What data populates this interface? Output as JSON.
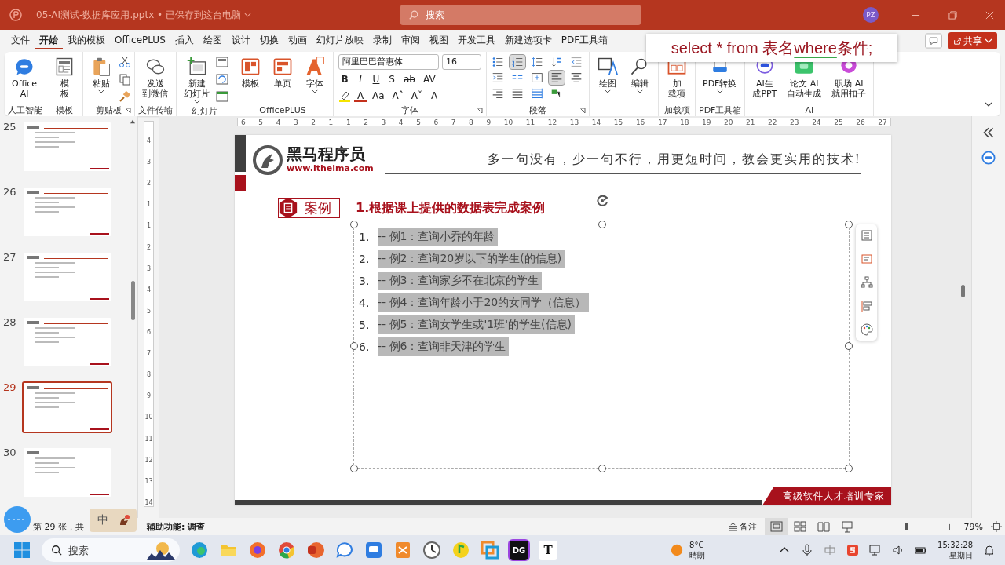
{
  "title_bar": {
    "file_title": "05-AI测试-数据库应用.pptx • 已保存到这台电脑",
    "search": {
      "placeholder": "搜索"
    },
    "avatar": "PZ"
  },
  "menu_tabs": [
    {
      "label": "文件",
      "selected": false
    },
    {
      "label": "开始",
      "selected": true
    },
    {
      "label": "我的模板",
      "selected": false
    },
    {
      "label": "OfficePLUS",
      "selected": false
    },
    {
      "label": "插入",
      "selected": false
    },
    {
      "label": "绘图",
      "selected": false
    },
    {
      "label": "设计",
      "selected": false
    },
    {
      "label": "切换",
      "selected": false
    },
    {
      "label": "动画",
      "selected": false
    },
    {
      "label": "幻灯片放映",
      "selected": false
    },
    {
      "label": "录制",
      "selected": false
    },
    {
      "label": "审阅",
      "selected": false
    },
    {
      "label": "视图",
      "selected": false
    },
    {
      "label": "开发工具",
      "selected": false
    },
    {
      "label": "新建选项卡",
      "selected": false
    },
    {
      "label": "PDF工具箱",
      "selected": false
    }
  ],
  "share_button": "共享",
  "sql_tooltip": {
    "before": "select * from 表名",
    "underlined": "where",
    "after": "条件;"
  },
  "ribbon_groups": [
    {
      "label": "人工智能",
      "kind": "large",
      "launcher": false,
      "items": [
        {
          "lines": [
            "Office",
            "AI"
          ],
          "kind": "ai",
          "dropdown": false
        }
      ]
    },
    {
      "label": "模板",
      "kind": "large",
      "launcher": false,
      "items": [
        {
          "lines": [
            "模",
            "板"
          ],
          "kind": "template",
          "dropdown": false
        }
      ]
    },
    {
      "label": "剪贴板",
      "kind": "clipboard",
      "launcher": true,
      "items": [
        {
          "lines": [
            "粘贴"
          ],
          "kind": "paste",
          "dropdown": true
        }
      ]
    },
    {
      "label": "文件传输",
      "kind": "large",
      "launcher": false,
      "items": [
        {
          "lines": [
            "发送",
            "到微信"
          ],
          "kind": "wechat",
          "dropdown": false
        }
      ]
    },
    {
      "label": "幻灯片",
      "kind": "slides",
      "launcher": false,
      "items": [
        {
          "lines": [
            "新建",
            "幻灯片"
          ],
          "kind": "newslide",
          "dropdown": true
        }
      ]
    },
    {
      "label": "OfficePLUS",
      "kind": "large",
      "launcher": false,
      "items": [
        {
          "lines": [
            "模板"
          ],
          "kind": "layout",
          "dropdown": false
        },
        {
          "lines": [
            "单页"
          ],
          "kind": "page",
          "dropdown": false
        },
        {
          "lines": [
            "字体"
          ],
          "kind": "font",
          "dropdown": true
        }
      ]
    },
    {
      "label": "字体",
      "kind": "font",
      "launcher": true,
      "font_name": "阿里巴巴普惠体",
      "font_size": "16",
      "row1": [
        {
          "kind": "bold",
          "text": "B"
        },
        {
          "kind": "italic",
          "text": "I"
        },
        {
          "kind": "underline",
          "text": "U"
        },
        {
          "kind": "shadow",
          "text": "S"
        },
        {
          "kind": "strike",
          "text": "ab"
        },
        {
          "kind": "spacing",
          "text": "AV"
        }
      ],
      "row2": [
        {
          "kind": "highlight"
        },
        {
          "kind": "color",
          "text": "A"
        },
        {
          "kind": "case",
          "text": "Aa"
        },
        {
          "kind": "grow",
          "text": "Aˆ"
        },
        {
          "kind": "shrink",
          "text": "Aˇ"
        },
        {
          "kind": "clear",
          "text": "A"
        }
      ]
    },
    {
      "label": "段落",
      "kind": "paragraph",
      "launcher": true,
      "items": [
        {
          "kind": "bullets",
          "selected": false
        },
        {
          "kind": "numbering",
          "selected": true
        },
        {
          "kind": "linespacing",
          "selected": false
        },
        {
          "kind": "direction",
          "selected": false
        },
        {
          "kind": "outdent",
          "selected": false
        },
        {
          "kind": "indent",
          "selected": false
        },
        {
          "kind": "columns",
          "selected": false
        },
        {
          "kind": "valign",
          "selected": false
        },
        {
          "kind": "left",
          "selected": true
        },
        {
          "kind": "center",
          "selected": false
        },
        {
          "kind": "right",
          "selected": false
        },
        {
          "kind": "justify",
          "selected": false
        },
        {
          "kind": "distribute",
          "selected": false
        },
        {
          "kind": "smartart",
          "selected": false
        }
      ]
    },
    {
      "kind": "large",
      "launcher": false,
      "items": [
        {
          "lines": [
            "绘图"
          ],
          "kind": "draw",
          "dropdown": true
        },
        {
          "lines": [
            "编辑"
          ],
          "kind": "search",
          "dropdown": true
        }
      ]
    },
    {
      "label": "加载项",
      "kind": "large",
      "launcher": false,
      "items": [
        {
          "lines": [
            "加",
            "载项"
          ],
          "kind": "addin",
          "dropdown": false
        }
      ]
    },
    {
      "label": "PDF工具箱",
      "kind": "large",
      "launcher": false,
      "items": [
        {
          "lines": [
            "PDF转换"
          ],
          "kind": "pdf",
          "dropdown": true
        }
      ]
    },
    {
      "label": "AI",
      "kind": "large",
      "launcher": false,
      "items": [
        {
          "lines": [
            "AI生",
            "成PPT"
          ],
          "kind": "aippt",
          "dropdown": false
        },
        {
          "lines": [
            "论文 AI",
            "自动生成"
          ],
          "kind": "paper",
          "dropdown": false
        },
        {
          "lines": [
            "职场 AI",
            "就用扣子"
          ],
          "kind": "coze",
          "dropdown": false
        }
      ]
    }
  ],
  "thumbnails": [
    {
      "number": "25",
      "selected": false
    },
    {
      "number": "26",
      "selected": false
    },
    {
      "number": "27",
      "selected": false
    },
    {
      "number": "28",
      "selected": false
    },
    {
      "number": "29",
      "selected": true
    },
    {
      "number": "30",
      "selected": false
    }
  ],
  "h_ruler": [
    "6",
    "5",
    "4",
    "3",
    "2",
    "1",
    "1",
    "2",
    "3",
    "4",
    "5",
    "6",
    "7",
    "8",
    "9",
    "10",
    "11",
    "12",
    "13",
    "14",
    "15",
    "16",
    "17",
    "18",
    "19",
    "20",
    "21",
    "22",
    "23",
    "24",
    "25",
    "26",
    "27"
  ],
  "v_ruler": [
    "4",
    "3",
    "2",
    "1",
    "1",
    "2",
    "3",
    "4",
    "5",
    "6",
    "7",
    "8",
    "9",
    "10",
    "11",
    "12",
    "13",
    "14"
  ],
  "slide": {
    "logo_name": "黑马程序员",
    "logo_url": "www.itheima.com",
    "slogan": "多一句没有，少一句不行，用更短时间，教会更实用的技术!",
    "badge": "案例",
    "heading": "1.根据课上提供的数据表完成案例",
    "items": [
      {
        "number": "1.",
        "text": "-- 例1：查询小乔的年龄",
        "selected": true
      },
      {
        "number": "2.",
        "text": "-- 例2：查询20岁以下的学生(的信息)",
        "selected": true
      },
      {
        "number": "3.",
        "text": "-- 例3：查询家乡不在北京的学生",
        "selected": true
      },
      {
        "number": "4.",
        "text": "-- 例4：查询年龄小于20的女同学（信息）",
        "selected": true
      },
      {
        "number": "5.",
        "text": "-- 例5：查询女学生或'1班'的学生(信息)",
        "selected": true
      },
      {
        "number": "6.",
        "text": "-- 例6：查询非天津的学生",
        "selected": true
      }
    ],
    "footer": "高级软件人才培训专家"
  },
  "status_bar": {
    "slide_info": "第 29 张，共",
    "ime": "中",
    "accessibility": "辅助功能: 调查",
    "notes": "备注",
    "views": [
      {
        "kind": "normal",
        "selected": true
      },
      {
        "kind": "sorter",
        "selected": false
      },
      {
        "kind": "reading",
        "selected": false
      },
      {
        "kind": "show",
        "selected": false
      }
    ],
    "zoom": {
      "level": 0.48,
      "reading": "79%"
    }
  },
  "taskbar": {
    "search": {
      "placeholder": "搜索"
    },
    "apps": [
      {
        "kind": "edge"
      },
      {
        "kind": "folder"
      },
      {
        "kind": "firefox"
      },
      {
        "kind": "chrome"
      },
      {
        "kind": "ppt"
      },
      {
        "kind": "chat"
      },
      {
        "kind": "message"
      },
      {
        "kind": "orange"
      },
      {
        "kind": "clock"
      },
      {
        "kind": "music"
      },
      {
        "kind": "boxes"
      },
      {
        "kind": "datagrip",
        "text": "DG"
      },
      {
        "kind": "typora",
        "text": "T"
      }
    ],
    "weather": {
      "temp": "8°C",
      "desc": "晴朗"
    },
    "clock": {
      "time": "15:32:28",
      "day": "星期日"
    }
  }
}
